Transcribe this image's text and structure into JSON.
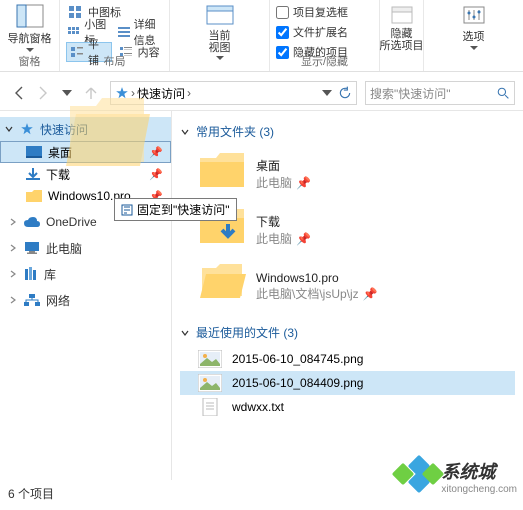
{
  "ribbon": {
    "group_pane": "窗格",
    "group_layout": "布局",
    "group_showhide": "显示/隐藏",
    "nav_pane": "导航窗格",
    "opt_medium": "中图标",
    "opt_small": "小图标",
    "opt_tile": "平铺",
    "opt_details": "详细信息",
    "opt_content": "内容",
    "current_view": "当前\n视图",
    "chk_checkbox": "项目复选框",
    "chk_ext": "文件扩展名",
    "chk_hidden": "隐藏的项目",
    "hide_btn": "隐藏\n所选项目",
    "options": "选项"
  },
  "crumbs": {
    "quick": "快速访问",
    "search_placeholder": "搜索\"快速访问\""
  },
  "sidebar": {
    "quick_access": "快速访问",
    "desktop": "桌面",
    "downloads": "下载",
    "win10": "Windows10.pro",
    "onedrive": "OneDrive",
    "thispc": "此电脑",
    "libraries": "库",
    "network": "网络"
  },
  "drag": {
    "tooltip": "固定到\"快速访问\""
  },
  "content": {
    "freq_head": "常用文件夹 (3)",
    "desktop": {
      "name": "桌面",
      "sub": "此电脑"
    },
    "downloads": {
      "name": "下载",
      "sub": "此电脑"
    },
    "win10": {
      "name": "Windows10.pro",
      "sub": "此电脑\\文档\\jsUp\\jz"
    },
    "recent_head": "最近使用的文件 (3)",
    "r1": "2015-06-10_084745.png",
    "r2": "2015-06-10_084409.png",
    "r3": "wdwxx.txt"
  },
  "status": "6 个项目",
  "watermark": {
    "t1": "系统城",
    "t2": "xitongcheng.com"
  }
}
